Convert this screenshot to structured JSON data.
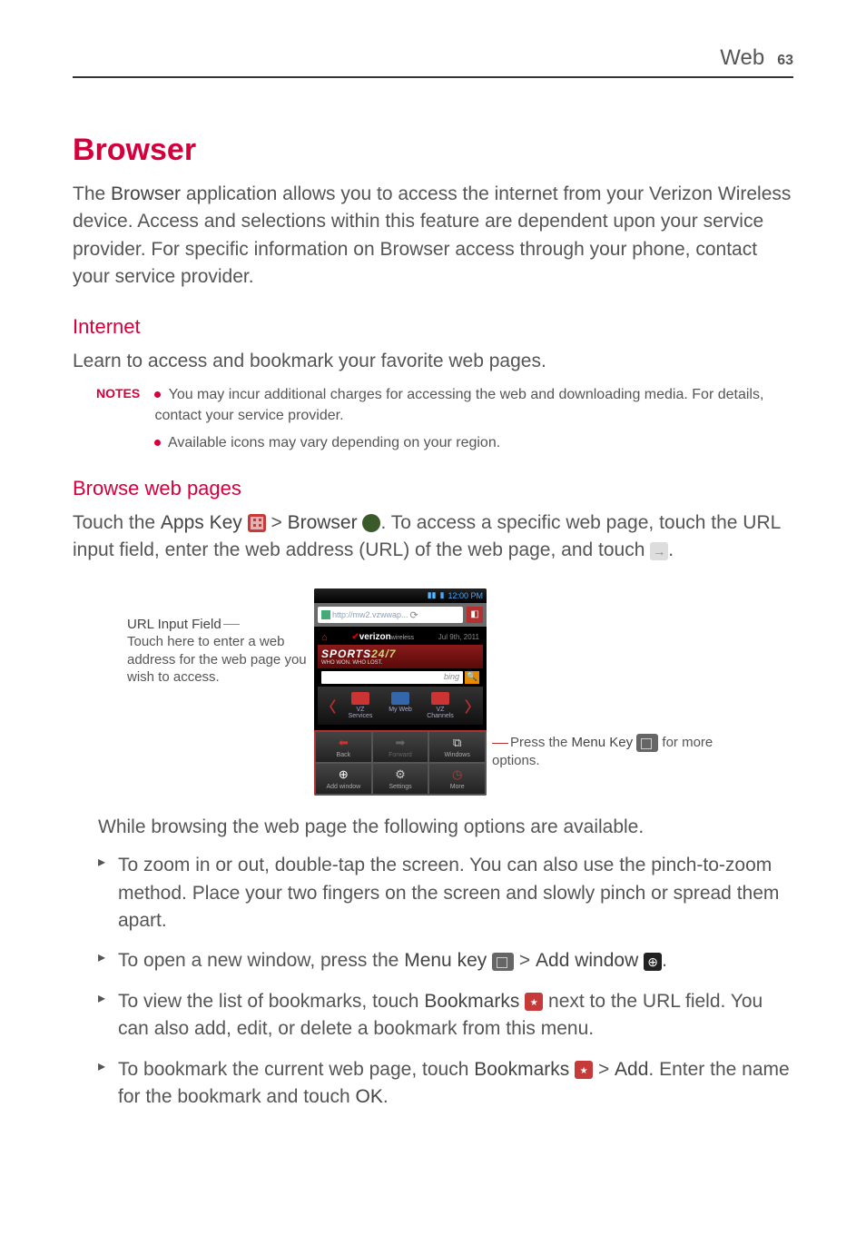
{
  "header": {
    "section": "Web",
    "page": "63"
  },
  "title": "Browser",
  "intro": "The Browser application allows you to access the internet from your Verizon Wireless device. Access and selections within this feature are dependent upon your service provider. For specific information on Browser access through your phone, contact your service provider.",
  "intro_bold": "Browser",
  "internet": {
    "heading": "Internet",
    "lead": "Learn to access and bookmark your favorite web pages.",
    "notes_label": "NOTES",
    "notes": [
      "You may incur additional charges for accessing the web and downloading media. For details, contact your service provider.",
      "Available icons may vary depending on your region."
    ]
  },
  "browse": {
    "heading": "Browse web pages",
    "p1_a": "Touch the ",
    "p1_apps": "Apps Key",
    "p1_b": " > ",
    "p1_browser": "Browser",
    "p1_c": ". To access a specific web page, touch the URL input field, enter the web address (URL) of the web page, and touch "
  },
  "figure": {
    "left_title": "URL Input Field",
    "left_desc": "Touch here to enter a web address for the web page you wish to access.",
    "right_a": "Press the ",
    "right_menu": "Menu Key",
    "right_b": " for more options.",
    "phone": {
      "time": "12:00 PM",
      "url": "http://mw2.vzwwap...",
      "carrier": "verizon",
      "carrier_suffix": "wireless",
      "date": "Jul 9th, 2011",
      "sports": "SPORTS",
      "sports247": "24/7",
      "sports_sub": "WHO WON. WHO LOST.",
      "bing": "bing",
      "carousel": [
        "VZ Services",
        "My Web",
        "VZ Channels"
      ],
      "menu": {
        "back": "Back",
        "forward": "Forward",
        "windows": "Windows",
        "add": "Add window",
        "settings": "Settings",
        "more": "More"
      }
    }
  },
  "after_figure": "While browsing the web page the following options are available.",
  "bullets": {
    "zoom": "To zoom in or out, double-tap the screen. You can also use the pinch-to-zoom method. Place your two fingers on the screen and slowly pinch or spread them apart.",
    "newwin_a": "To open a new window, press the ",
    "newwin_menu": "Menu key",
    "newwin_b": " > ",
    "newwin_add": "Add window",
    "bookmarks_a": "To view the list of bookmarks, touch ",
    "bookmarks_label": "Bookmarks",
    "bookmarks_b": " next to the URL field. You can also add, edit, or delete a bookmark from this menu.",
    "addbm_a": "To bookmark the current web page, touch ",
    "addbm_bm": "Bookmarks",
    "addbm_b": " > ",
    "addbm_add": "Add",
    "addbm_c": ". Enter the name for the bookmark and touch ",
    "addbm_ok": "OK"
  }
}
